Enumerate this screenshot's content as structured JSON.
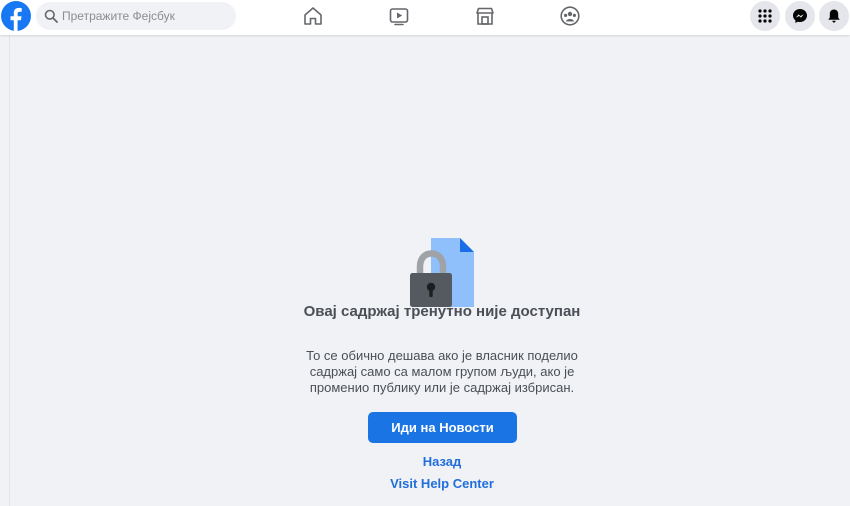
{
  "header": {
    "logo_icon": "facebook-logo-icon",
    "search": {
      "placeholder": "Претражите Фејсбук",
      "icon": "search-icon"
    },
    "nav": [
      {
        "name": "home",
        "icon": "home-icon"
      },
      {
        "name": "watch",
        "icon": "video-icon"
      },
      {
        "name": "marketplace",
        "icon": "store-icon"
      },
      {
        "name": "groups",
        "icon": "groups-icon"
      }
    ],
    "actions": [
      {
        "name": "menu",
        "icon": "grid-menu-icon"
      },
      {
        "name": "messenger",
        "icon": "messenger-icon"
      },
      {
        "name": "notifications",
        "icon": "bell-icon"
      }
    ]
  },
  "main": {
    "illustration_icon": "locked-document-icon",
    "title": "Овај садржај тренутно није доступан",
    "description": "То се обично дешава ако је власник поделио садржај само са малом групом људи, ако је променио публику или је садржај избрисан.",
    "primary_button": "Иди на Новости",
    "back_link": "Назад",
    "help_link": "Visit Help Center"
  },
  "colors": {
    "brand": "#1877f2",
    "primary_button": "#1b74e4",
    "link": "#216fdb",
    "background": "#f0f2f5",
    "text": "#4b4f56"
  }
}
